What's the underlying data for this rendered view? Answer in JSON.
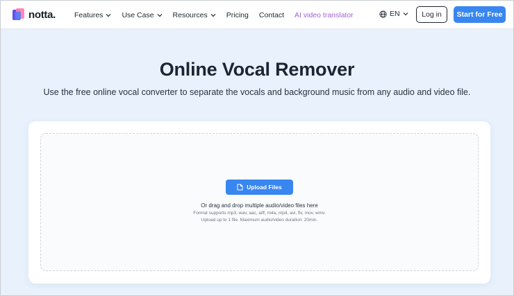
{
  "brand": {
    "name": "notta."
  },
  "nav": {
    "items": [
      {
        "label": "Features",
        "dropdown": true
      },
      {
        "label": "Use Case",
        "dropdown": true
      },
      {
        "label": "Resources",
        "dropdown": true
      },
      {
        "label": "Pricing",
        "dropdown": false
      },
      {
        "label": "Contact",
        "dropdown": false
      },
      {
        "label": "AI video translator",
        "dropdown": false,
        "highlight": true
      }
    ],
    "language": "EN",
    "login_label": "Log in",
    "start_label": "Start for Free"
  },
  "hero": {
    "title": "Online Vocal Remover",
    "subtitle": "Use the free online vocal converter to separate the vocals and background music from any audio and video file."
  },
  "upload": {
    "button_label": "Upload Files",
    "drop_text": "Or drag and drop multiple audio/video files here",
    "formats_text": "Format supports mp3, wav, aac, aiff, m4a, mp4, avi, flv, mov, wmv.",
    "limit_text": "Upload up to 1 file. Maximum audio/video duration: 20min."
  },
  "colors": {
    "accent": "#3886f0",
    "highlight_link": "#a55fd6",
    "page_background": "#e8f1fc",
    "heading": "#1b2534"
  }
}
